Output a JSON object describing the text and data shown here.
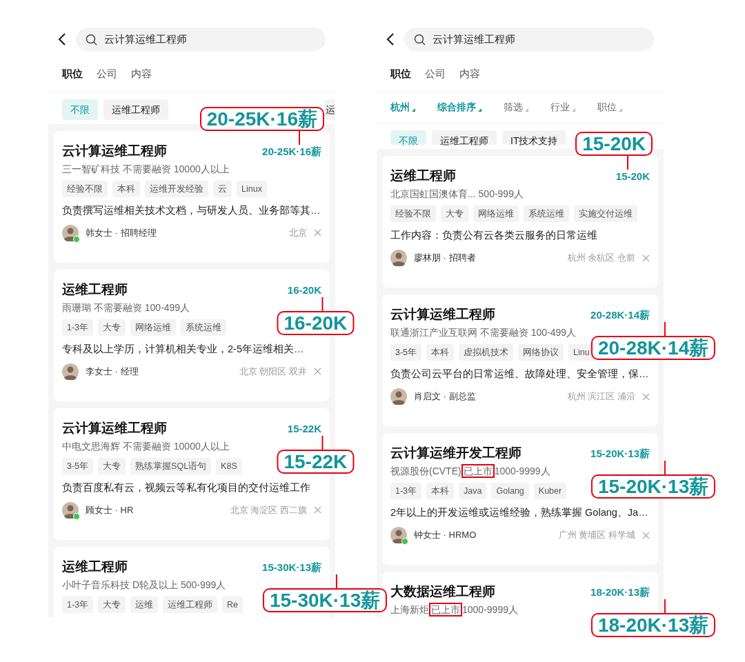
{
  "panels": [
    {
      "search": {
        "value": "云计算运维工程师"
      },
      "tabs": [
        {
          "label": "职位",
          "selected": true
        },
        {
          "label": "公司",
          "selected": false
        },
        {
          "label": "内容",
          "selected": false
        }
      ],
      "chips": [
        {
          "kind": "text",
          "label": "不限",
          "selected": true
        },
        {
          "kind": "text",
          "label": "运维工程师",
          "selected": false
        },
        {
          "kind": "edge",
          "label": "运",
          "selected": false
        }
      ],
      "jobs": [
        {
          "title": "云计算运维工程师",
          "salary": "20-25K·16薪",
          "callout": {
            "text": "20-25K·16薪"
          },
          "company": [
            {
              "text": "三一智矿科技 不需要融资 10000人以上",
              "highlighted": false
            }
          ],
          "tags": [
            "经验不限",
            "本科",
            "运维开发经验",
            "云",
            "Linux"
          ],
          "description": "负责撰写运维相关技术文档，与研发人员、业务部等其…",
          "recruiter": {
            "name": "韩女士 · 招聘经理",
            "online": true
          },
          "location": "北京"
        },
        {
          "title": "运维工程师",
          "salary": "16-20K",
          "callout": {
            "text": "16-20K"
          },
          "company": [
            {
              "text": "雨珊瑚 不需要融资 100-499人",
              "highlighted": false
            }
          ],
          "tags": [
            "1-3年",
            "大专",
            "网络运维",
            "系统运维"
          ],
          "description": "专科及以上学历，计算机相关专业，2-5年运维相关…",
          "recruiter": {
            "name": "李女士 · 经理",
            "online": false
          },
          "location": "北京 朝阳区 双井"
        },
        {
          "title": "云计算运维工程师",
          "salary": "15-22K",
          "callout": {
            "text": "15-22K"
          },
          "company": [
            {
              "text": "中电文思海辉 不需要融资 10000人以上",
              "highlighted": false
            }
          ],
          "tags": [
            "3-5年",
            "大专",
            "熟练掌握SQL语句",
            "K8S"
          ],
          "description": "负责百度私有云，视频云等私有化项目的交付运维工作",
          "recruiter": {
            "name": "顾女士 · HR",
            "online": true
          },
          "location": "北京 海淀区 西二旗"
        },
        {
          "title": "运维工程师",
          "salary": "15-30K·13薪",
          "callout": {
            "text": "15-30K·13薪"
          },
          "company": [
            {
              "text": "小叶子音乐科技 D轮及以上 500-999人",
              "highlighted": false
            }
          ],
          "tags": [
            "1-3年",
            "大专",
            "运维",
            "运维工程师",
            "Re"
          ]
        }
      ]
    },
    {
      "search": {
        "value": "云计算运维工程师"
      },
      "tabs": [
        {
          "label": "职位",
          "selected": true
        },
        {
          "label": "公司",
          "selected": false
        },
        {
          "label": "内容",
          "selected": false
        }
      ],
      "sort_filters": [
        {
          "label": "杭州",
          "active": true
        },
        {
          "label": "综合排序",
          "active": true
        },
        {
          "label": "筛选",
          "active": false
        },
        {
          "label": "行业",
          "active": false
        },
        {
          "label": "职位",
          "active": false
        }
      ],
      "chips": [
        {
          "kind": "text",
          "label": "不限",
          "selected": true
        },
        {
          "kind": "text",
          "label": "运维工程师",
          "selected": false
        },
        {
          "kind": "text",
          "label": "IT技术支持",
          "selected": false
        }
      ],
      "jobs": [
        {
          "title": "运维工程师",
          "salary": "15-20K",
          "callout": {
            "text": "15-20K"
          },
          "company": [
            {
              "text": "北京国虹国澳体育... 500-999人",
              "highlighted": false
            }
          ],
          "tags": [
            "经验不限",
            "大专",
            "网络运维",
            "系统运维",
            "实施交付运维"
          ],
          "description": "工作内容：负责公有云各类云服务的日常运维",
          "recruiter": {
            "name": "廖林朋 · 招聘者",
            "online": false
          },
          "location": "杭州 余杭区 仓前"
        },
        {
          "title": "云计算运维工程师",
          "salary": "20-28K·14薪",
          "callout": {
            "text": "20-28K·14薪"
          },
          "company": [
            {
              "text": "联通浙江产业互联网 不需要融资 100-499人",
              "highlighted": false
            }
          ],
          "tags": [
            "3-5年",
            "本科",
            "虚拟机技术",
            "网络协议",
            "Linu"
          ],
          "description": "负责公司云平台的日常运维、故障处理、安全管理，保…",
          "recruiter": {
            "name": "肖启文 · 副总监",
            "online": false
          },
          "location": "杭州 滨江区 浦沿"
        },
        {
          "title": "云计算运维开发工程师",
          "salary": "15-20K·13薪",
          "callout": {
            "text": "15-20K·13薪"
          },
          "company": [
            {
              "text": "视源股份(CVTE)",
              "highlighted": false
            },
            {
              "text": "已上市",
              "highlighted": true
            },
            {
              "text": "1000-9999人",
              "highlighted": false
            }
          ],
          "tags": [
            "1-3年",
            "本科",
            "Java",
            "Golang",
            "Kuber"
          ],
          "description": "2年以上的开发运维或运维经验，熟练掌握 Golang、Ja…",
          "recruiter": {
            "name": "钟女士 · HRMO",
            "online": true
          },
          "location": "广州 黄埔区 科学城"
        },
        {
          "title": "大数据运维工程师",
          "salary": "18-20K·13薪",
          "callout": {
            "text": "18-20K·13薪"
          },
          "company": [
            {
              "text": "上海新炬",
              "highlighted": false
            },
            {
              "text": "已上市",
              "highlighted": true
            },
            {
              "text": "1000-9999人",
              "highlighted": false
            }
          ]
        }
      ]
    }
  ]
}
